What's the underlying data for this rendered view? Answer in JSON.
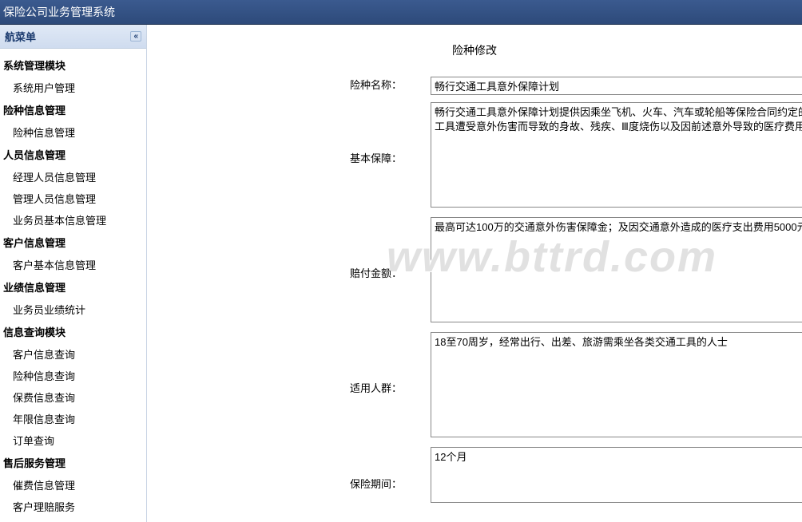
{
  "app": {
    "title": "保险公司业务管理系统"
  },
  "sidebar": {
    "header": "航菜单",
    "groups": [
      {
        "title": "系统管理模块",
        "items": [
          "系统用户管理"
        ]
      },
      {
        "title": "险种信息管理",
        "items": [
          "险种信息管理"
        ]
      },
      {
        "title": "人员信息管理",
        "items": [
          "经理人员信息管理",
          "管理人员信息管理",
          "业务员基本信息管理"
        ]
      },
      {
        "title": "客户信息管理",
        "items": [
          "客户基本信息管理"
        ]
      },
      {
        "title": "业绩信息管理",
        "items": [
          "业务员业绩统计"
        ]
      },
      {
        "title": "信息查询模块",
        "items": [
          "客户信息查询",
          "险种信息查询",
          "保费信息查询",
          "年限信息查询",
          "订单查询"
        ]
      },
      {
        "title": "售后服务管理",
        "items": [
          "催费信息管理",
          "客户理赔服务"
        ]
      }
    ]
  },
  "page": {
    "title": "险种修改"
  },
  "form": {
    "name_label": "险种名称：",
    "name_value": "畅行交通工具意外保障计划",
    "coverage_label": "基本保障：",
    "coverage_value": "畅行交通工具意外保障计划提供因乘坐飞机、火车、汽车或轮船等保险合同约定的交通工具遭受意外伤害而导致的身故、残疾、Ⅲ度烧伤以及因前述意外导致的医疗费用",
    "amount_label": "赔付金额：",
    "amount_value": "最高可达100万的交通意外伤害保障金；及因交通意外造成的医疗支出费用5000元",
    "people_label": "适用人群：",
    "people_value": "18至70周岁，经常出行、出差、旅游需乘坐各类交通工具的人士",
    "period_label": "保险期间：",
    "period_value": "12个月"
  },
  "watermark": "www.bttrd.com"
}
